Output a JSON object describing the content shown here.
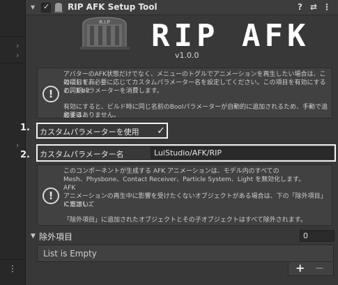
{
  "header": {
    "title": "RIP AFK Setup Tool",
    "enabled": true,
    "help_icon": "help-icon",
    "presets_icon": "presets-icon",
    "menu_icon": "kebab-menu-icon"
  },
  "logo": {
    "text": "RIP AFK",
    "box_label": "R.I.P",
    "version": "v1.0.0"
  },
  "help_top": {
    "line1": "アバターのAFK状態だけでなく、メニューのトグルでアニメーションを再生したい場合は、この項目を有",
    "line2": "効にして、必要に応じてカスタムパラメーター名を設定してください。この項目を有効にすると、1 bit",
    "line3": "の同期パラメーターを消費します。",
    "line4": "有効にすると、ビルド時に同じ名前のBoolパラメーターが自動的に追加されるため、手動で追加する",
    "line5": "必要はありません。"
  },
  "annotations": {
    "first": "1.",
    "second": "2."
  },
  "toggle": {
    "label": "カスタムパラメーターを使用",
    "checked": true,
    "check_glyph": "✓"
  },
  "param_field": {
    "label": "カスタムパラメーター名",
    "value": "LuiStudio/AFK/RIP"
  },
  "help_bottom": {
    "line1": "このコンポーネントが生成する AFK アニメーションは、モデル内のすべての",
    "line2": "Mesh、Physbone、Contact Receiver、Particle System、Light を無効化します。",
    "line3": "AFK",
    "line4": "アニメーションの再生中に影響を受けたくないオブジェクトがある場合は、下の「除外項目」に追加して",
    "line5": "ください。",
    "line6": "「除外項目」に追加されたオブジェクトとその子オブジェクトはすべて除外されます。"
  },
  "exclude": {
    "label": "除外項目",
    "count": "0",
    "empty_text": "List is Empty",
    "add": "+",
    "remove": "−"
  },
  "colors": {
    "background": "#383838",
    "left_strip": "#282828",
    "field_bg": "#2a2a2a",
    "highlight_border": "#f2f2f2"
  }
}
